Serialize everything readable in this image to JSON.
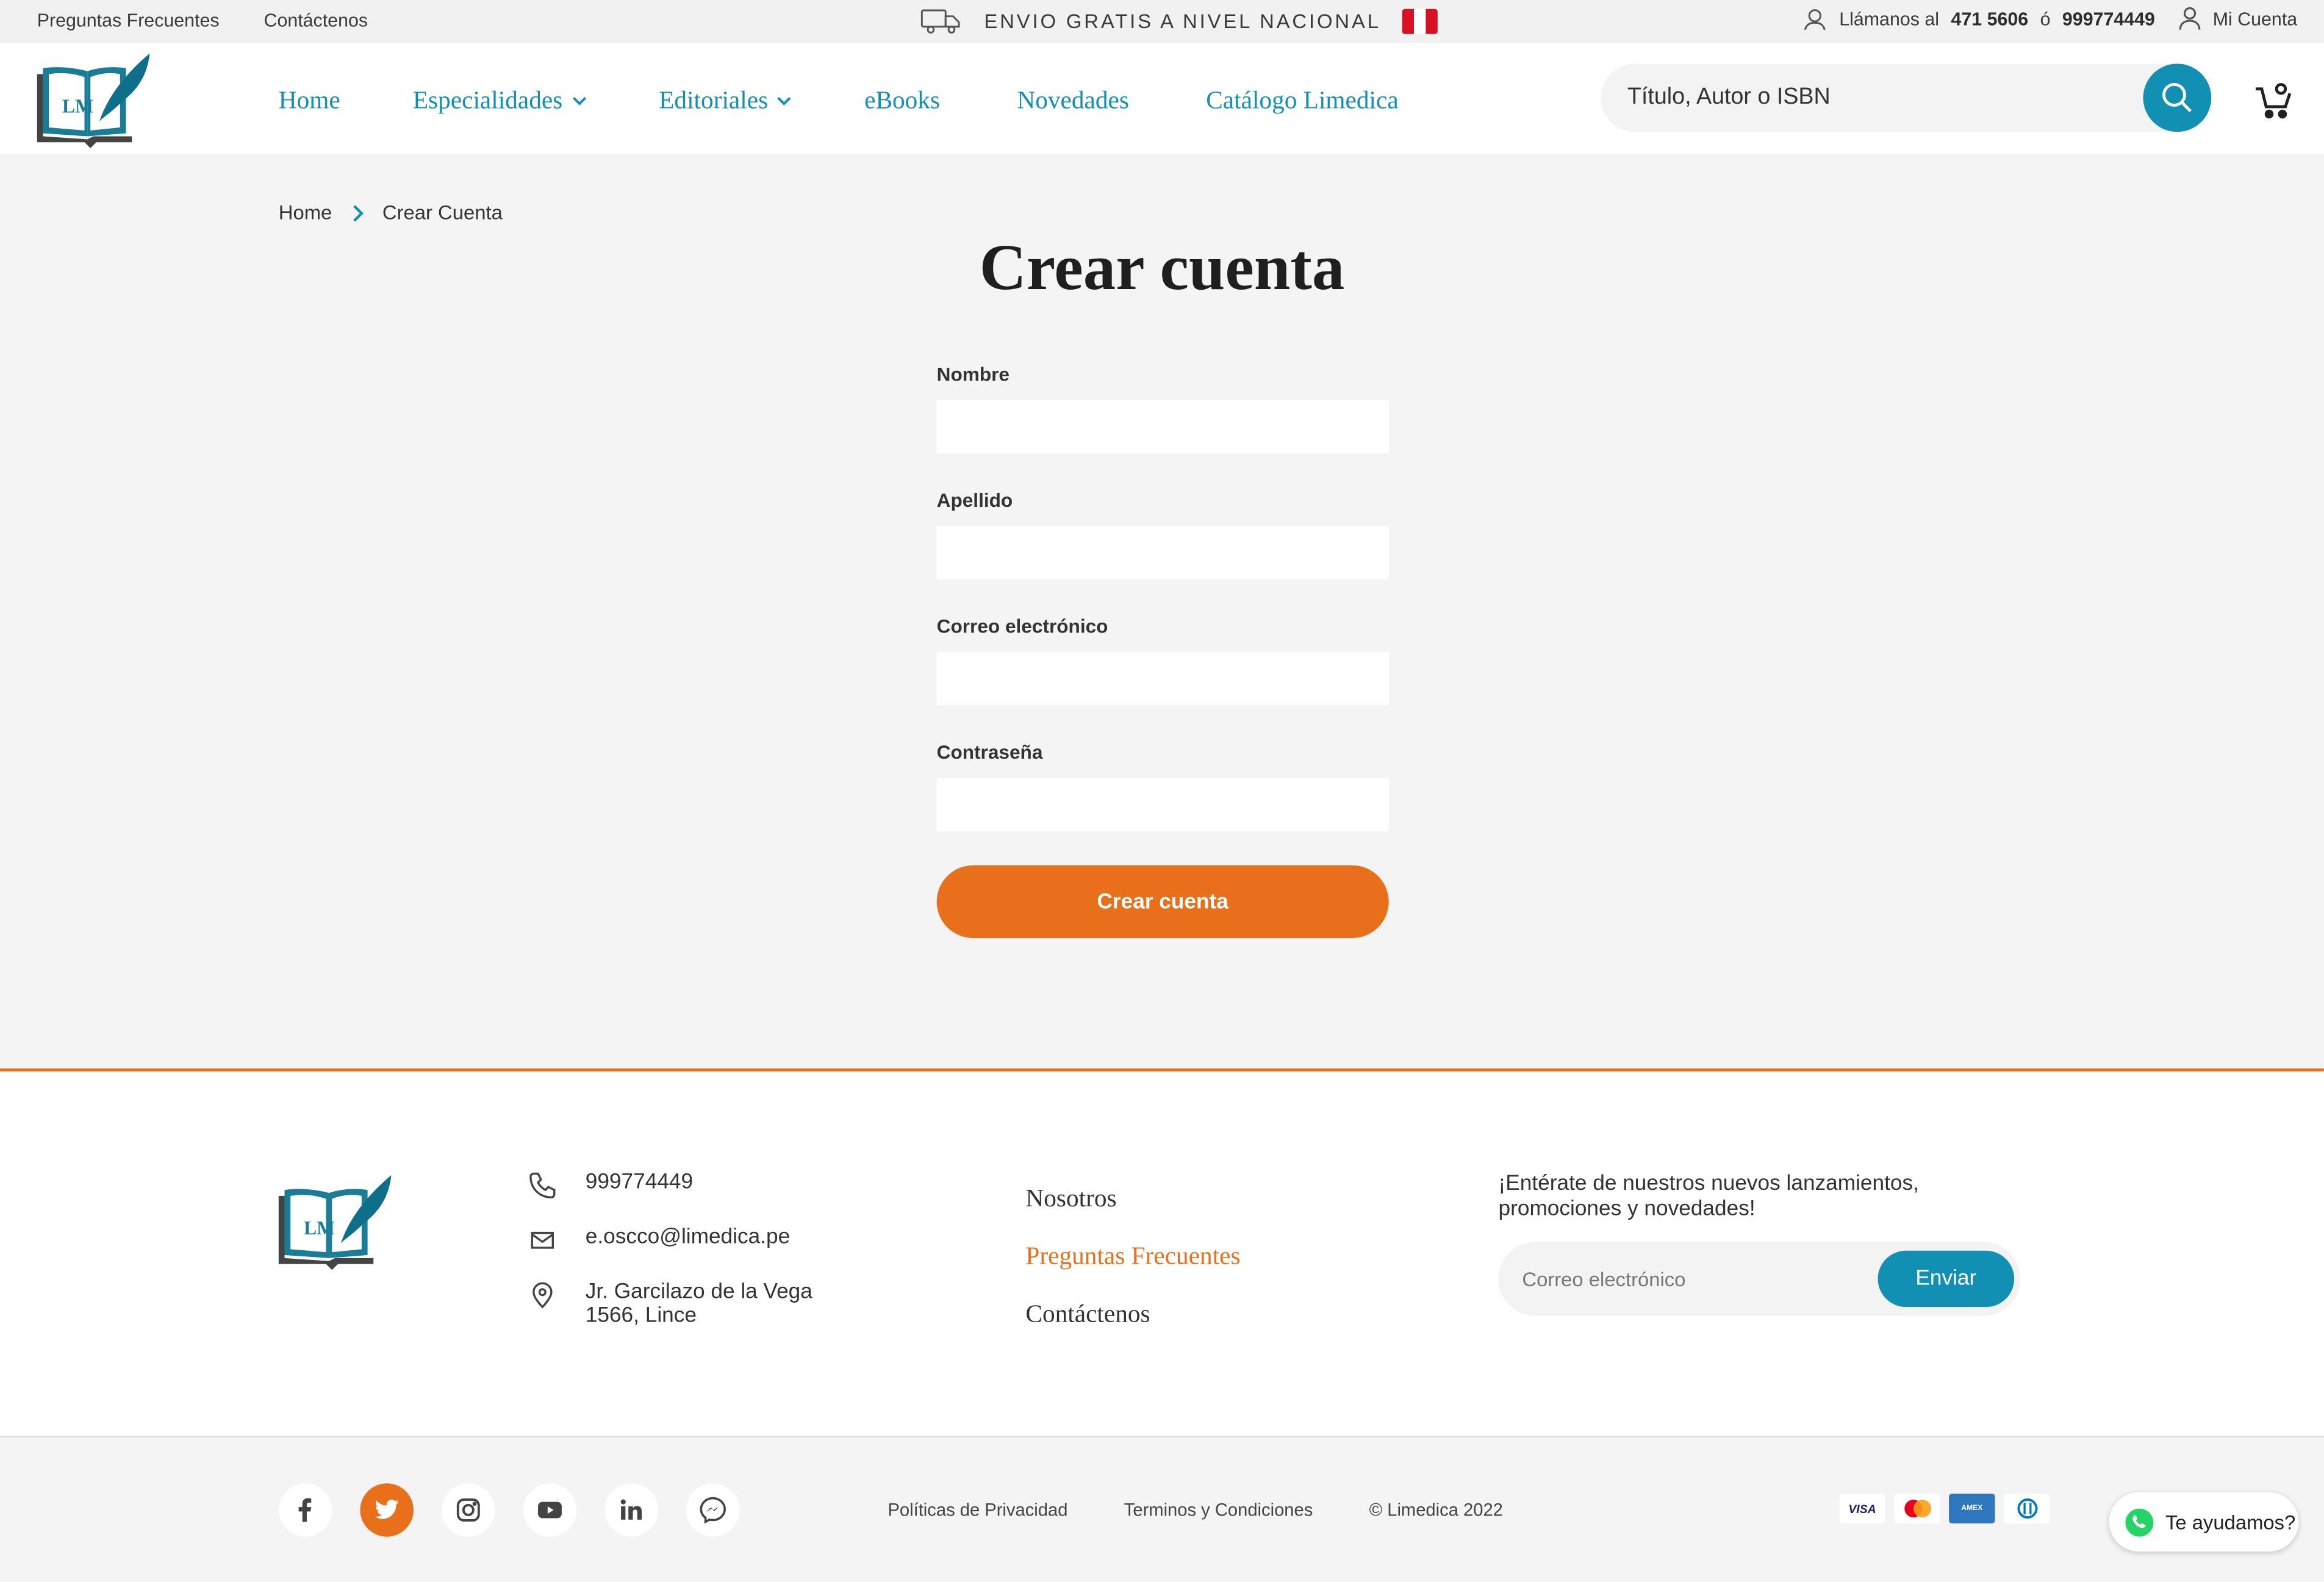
{
  "topbar": {
    "faq": "Preguntas Frecuentes",
    "contact": "Contáctenos",
    "shipping": "ENVIO GRATIS A NIVEL NACIONAL",
    "call_label": "Llámanos al",
    "phone1": "471 5606",
    "or": "ó",
    "phone2": "999774449",
    "account": "Mi Cuenta"
  },
  "logo": {
    "text": "LM"
  },
  "nav": {
    "items": [
      "Home",
      "Especialidades",
      "Editoriales",
      "eBooks",
      "Novedades",
      "Catálogo Limedica"
    ]
  },
  "search": {
    "placeholder": "Título, Autor o ISBN"
  },
  "breadcrumb": {
    "home": "Home",
    "current": "Crear Cuenta"
  },
  "page": {
    "title": "Crear cuenta"
  },
  "form": {
    "first_name_label": "Nombre",
    "last_name_label": "Apellido",
    "email_label": "Correo electrónico",
    "password_label": "Contraseña",
    "submit": "Crear cuenta"
  },
  "footer": {
    "phone": "999774449",
    "email": "e.oscco@limedica.pe",
    "address_line1": "Jr. Garcilazo de la Vega",
    "address_line2": "1566, Lince",
    "links": [
      "Nosotros",
      "Preguntas Frecuentes",
      "Contáctenos"
    ],
    "newsletter_text": "¡Entérate de nuestros nuevos lanzamientos, promociones y novedades!",
    "newsletter_placeholder": "Correo electrónico",
    "newsletter_button": "Enviar"
  },
  "bottom": {
    "privacy": "Políticas de Privacidad",
    "terms": "Terminos y Condiciones",
    "copyright": "© Limedica 2022",
    "social_icons": [
      "facebook-icon",
      "twitter-icon",
      "instagram-icon",
      "youtube-icon",
      "linkedin-icon",
      "messenger-icon"
    ],
    "payment_icons": [
      "visa-icon",
      "mastercard-icon",
      "amex-icon",
      "diners-icon"
    ],
    "whatsapp": "Te ayudamos?"
  },
  "colors": {
    "brand_blue": "#1190b3",
    "accent_orange": "#e8701a"
  }
}
